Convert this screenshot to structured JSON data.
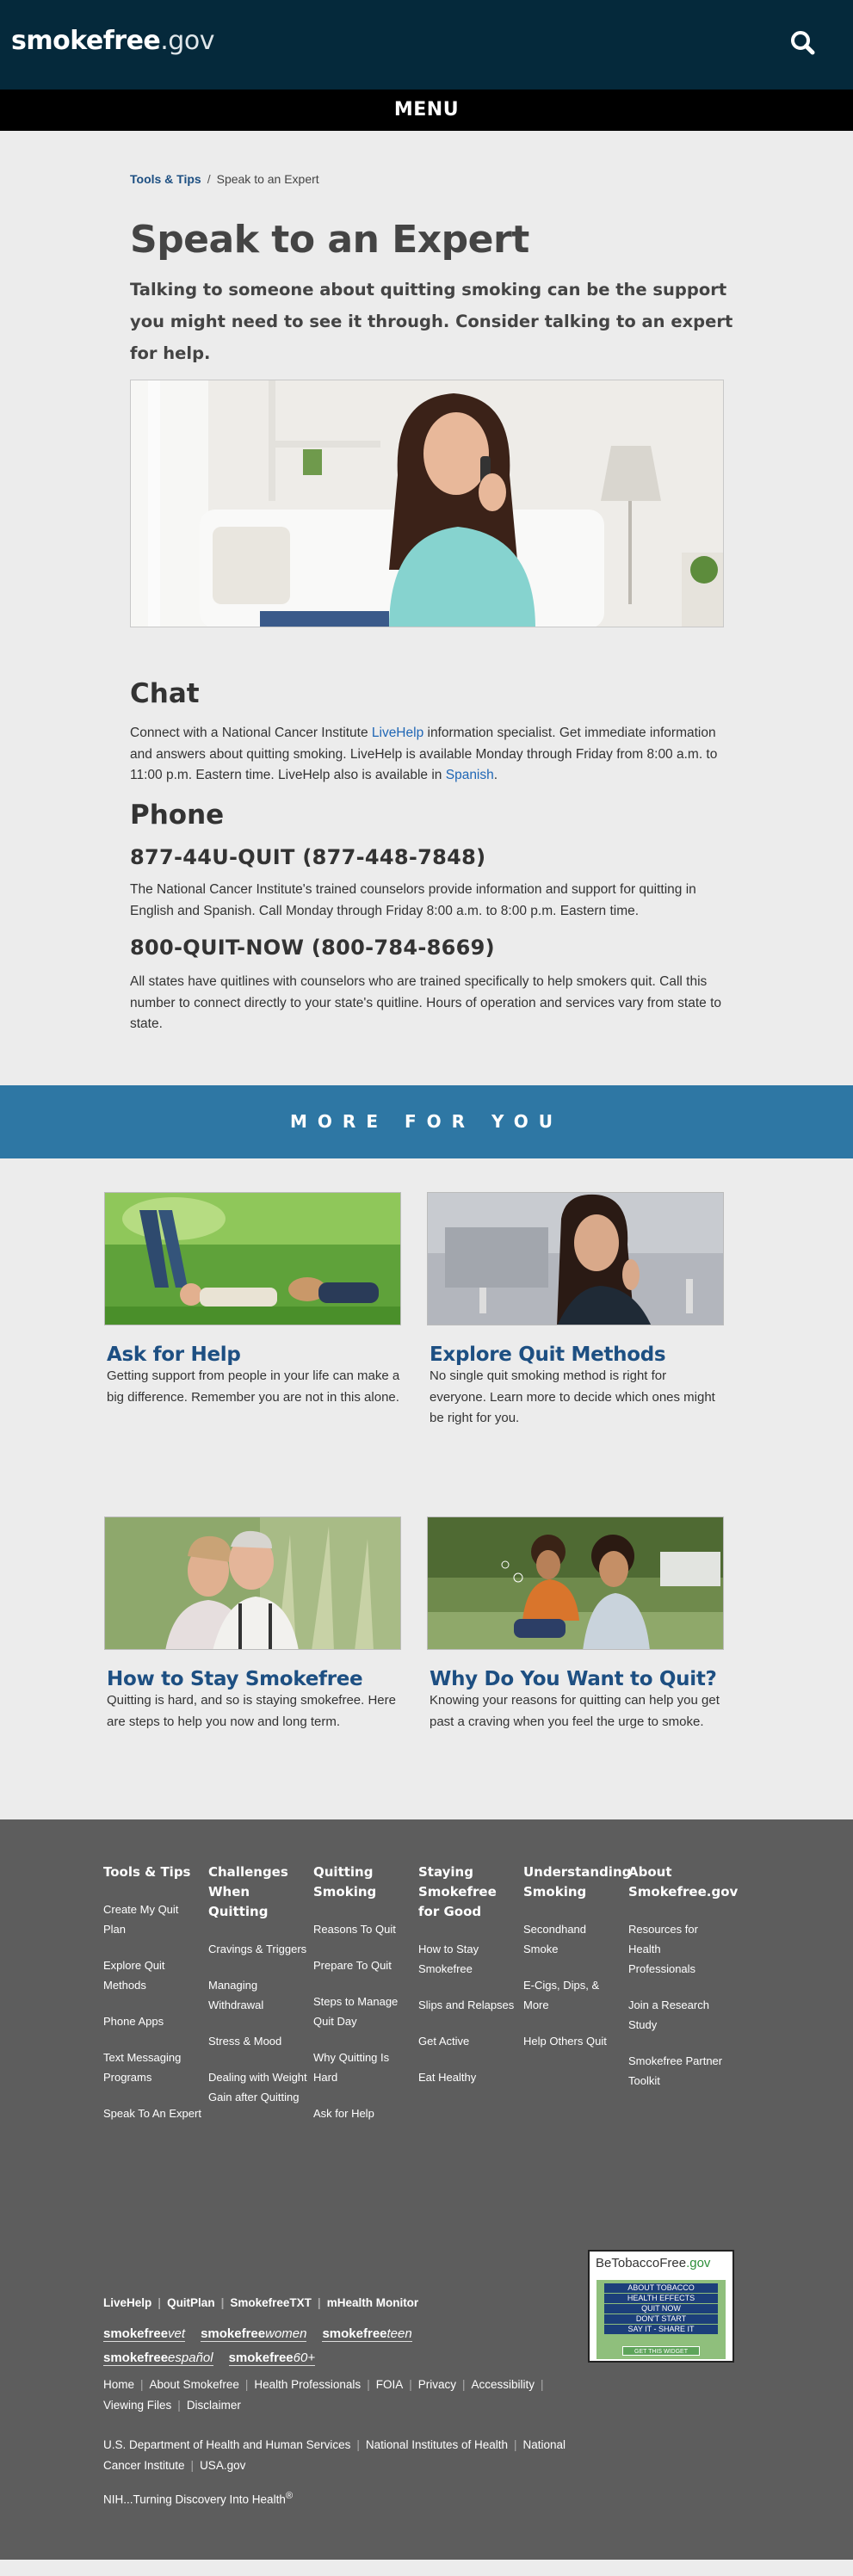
{
  "header": {
    "logo_main": "smokefree",
    "logo_suffix": ".gov",
    "menu_label": "MENU"
  },
  "breadcrumb": {
    "parent": "Tools & Tips",
    "separator": "/",
    "current": "Speak to an Expert"
  },
  "page": {
    "title": "Speak to an Expert",
    "lead": "Talking to someone about quitting smoking can be the support you might need to see it through. Consider talking to an expert for help."
  },
  "chat": {
    "heading": "Chat",
    "text_1": "Connect with a National Cancer Institute ",
    "link_livehelp": "LiveHelp",
    "text_2": " information specialist. Get immediate information and answers about quitting smoking. LiveHelp is available Monday through Friday from 8:00 a.m. to 11:00 p.m. Eastern time. LiveHelp also is available in ",
    "link_spanish": "Spanish",
    "text_3": "."
  },
  "phone": {
    "heading": "Phone",
    "number_1": "877-44U-QUIT (877-448-7848)",
    "desc_1": "The National Cancer Institute's trained counselors provide information and support for quitting in English and Spanish. Call Monday through Friday 8:00 a.m. to 8:00 p.m. Eastern time.",
    "number_2": "800-QUIT-NOW (800-784-8669)",
    "desc_2": "All states have quitlines with counselors who are trained specifically to help smokers quit. Call this number to connect directly to your state's quitline. Hours of operation and services vary from state to state."
  },
  "more": {
    "heading": "MORE FOR YOU",
    "cards": [
      {
        "title": "Ask for Help",
        "text": "Getting support from people in your life can make a big difference. Remember you are not in this alone."
      },
      {
        "title": "Explore Quit Methods",
        "text": "No single quit smoking method is right for everyone. Learn more to decide which ones might be right for you."
      },
      {
        "title": "How to Stay Smokefree",
        "text": "Quitting is hard, and so is staying smokefree. Here are steps to help you now and long term."
      },
      {
        "title": "Why Do You Want to Quit?",
        "text": "Knowing your reasons for quitting can help you get past a craving when you feel the urge to smoke."
      }
    ]
  },
  "footer": {
    "columns": [
      {
        "heading": "Tools & Tips",
        "links": [
          "Create My Quit Plan",
          "Explore Quit Methods",
          "Phone Apps",
          "Text Messaging Programs",
          "Speak To An Expert"
        ]
      },
      {
        "heading": "Challenges When Quitting",
        "links": [
          "Cravings & Triggers",
          "Managing Withdrawal",
          "Stress & Mood",
          "Dealing with Weight Gain after Quitting"
        ]
      },
      {
        "heading": "Quitting Smoking",
        "links": [
          "Reasons To Quit",
          "Prepare To Quit",
          "Steps to Manage Quit Day",
          "Why Quitting Is Hard",
          "Ask for Help"
        ]
      },
      {
        "heading": "Staying Smokefree for Good",
        "links": [
          "How to Stay Smokefree",
          "Slips and Relapses",
          "Get Active",
          "Eat Healthy"
        ]
      },
      {
        "heading": "Understanding Smoking",
        "links": [
          "Secondhand Smoke",
          "E-Cigs, Dips, & More",
          "Help Others Quit"
        ]
      },
      {
        "heading": "About Smokefree.gov",
        "links": [
          "Resources for Health Professionals",
          "Join a Research Study",
          "Smokefree Partner Toolkit"
        ]
      }
    ],
    "programs": [
      "LiveHelp",
      "QuitPlan",
      "SmokefreeTXT",
      "mHealth Monitor"
    ],
    "brands": {
      "vet_a": "smokefree",
      "vet_b": "vet",
      "women_a": "smokefree",
      "women_b": "women",
      "teen_a": "smokefree",
      "teen_b": "teen",
      "espanol_a": "smokefree",
      "espanol_b": "español",
      "sixty_a": "smokefree",
      "sixty_b": "60+"
    },
    "site_links": [
      "Home",
      "About Smokefree",
      "Health Professionals",
      "FOIA",
      "Privacy",
      "Accessibility",
      "Viewing Files",
      "Disclaimer"
    ],
    "gov_links": [
      "U.S. Department of Health and Human Services",
      "National Institutes of Health",
      "National Cancer Institute",
      "USA.gov"
    ],
    "tagline": "NIH...Turning Discovery Into Health",
    "tagline_mark": "®",
    "widget": {
      "title_a": "BeTobaccoFree",
      "title_b": ".gov",
      "rows": [
        "ABOUT TOBACCO",
        "HEALTH EFFECTS",
        "QUIT NOW",
        "DON'T START",
        "SAY IT - SHARE IT"
      ],
      "button": "GET THIS WIDGET"
    }
  }
}
